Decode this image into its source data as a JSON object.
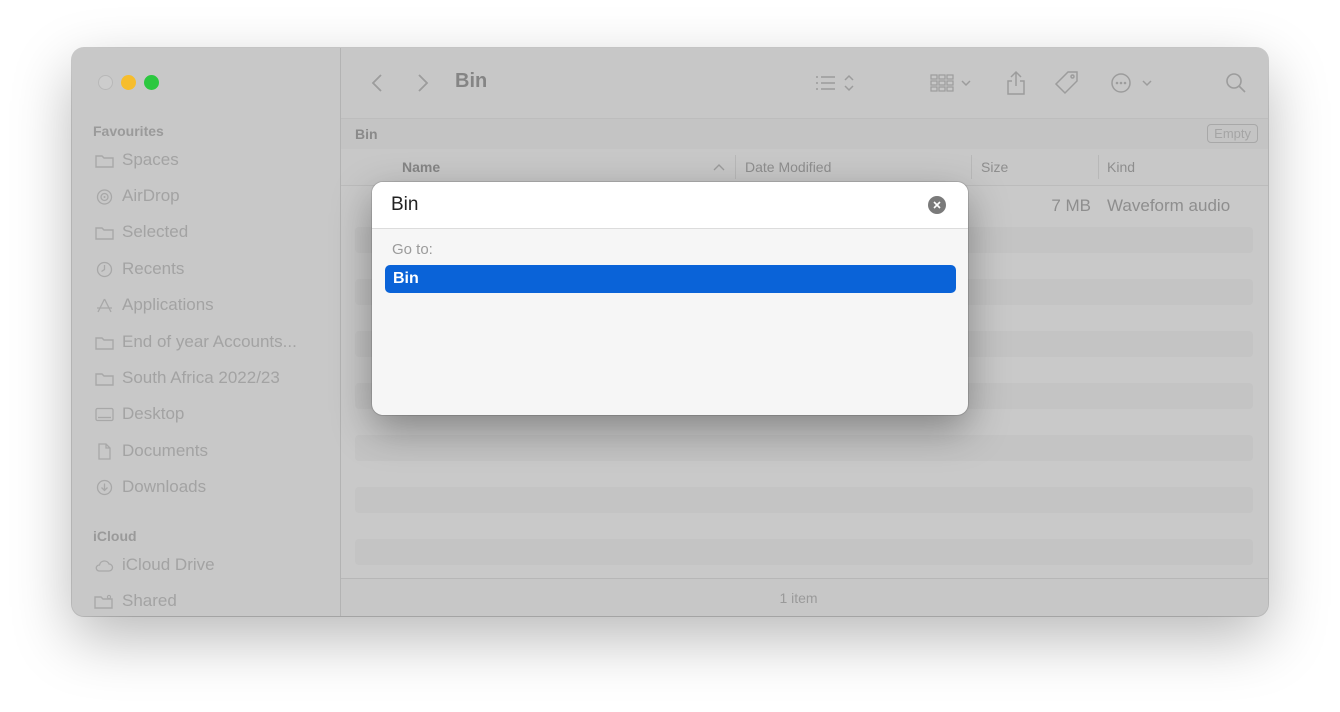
{
  "window": {
    "title": "Bin"
  },
  "sidebar": {
    "sections": {
      "favourites": "Favourites",
      "icloud": "iCloud"
    },
    "favourites": [
      {
        "label": "Spaces",
        "icon": "folder-icon"
      },
      {
        "label": "AirDrop",
        "icon": "airdrop-icon"
      },
      {
        "label": "Selected",
        "icon": "folder-icon"
      },
      {
        "label": "Recents",
        "icon": "clock-icon"
      },
      {
        "label": "Applications",
        "icon": "applications-icon"
      },
      {
        "label": "End of year Accounts...",
        "icon": "folder-icon"
      },
      {
        "label": "South Africa 2022/23",
        "icon": "folder-icon"
      },
      {
        "label": "Desktop",
        "icon": "desktop-icon"
      },
      {
        "label": "Documents",
        "icon": "document-icon"
      },
      {
        "label": "Downloads",
        "icon": "download-icon"
      }
    ],
    "icloud": [
      {
        "label": "iCloud Drive",
        "icon": "cloud-icon"
      },
      {
        "label": "Shared",
        "icon": "shared-folder-icon"
      }
    ]
  },
  "pathbar": {
    "location": "Bin",
    "empty_label": "Empty"
  },
  "columns": {
    "name": "Name",
    "date_modified": "Date Modified",
    "size": "Size",
    "kind": "Kind"
  },
  "file": {
    "size": "7 MB",
    "kind": "Waveform audio"
  },
  "status": {
    "item_count": "1 item"
  },
  "goto_dialog": {
    "input_value": "Bin",
    "section_label": "Go to:",
    "result": "Bin"
  },
  "colors": {
    "accent": "#0a63d8",
    "traffic_min": "#f6bd2d",
    "traffic_max": "#2cc840"
  }
}
